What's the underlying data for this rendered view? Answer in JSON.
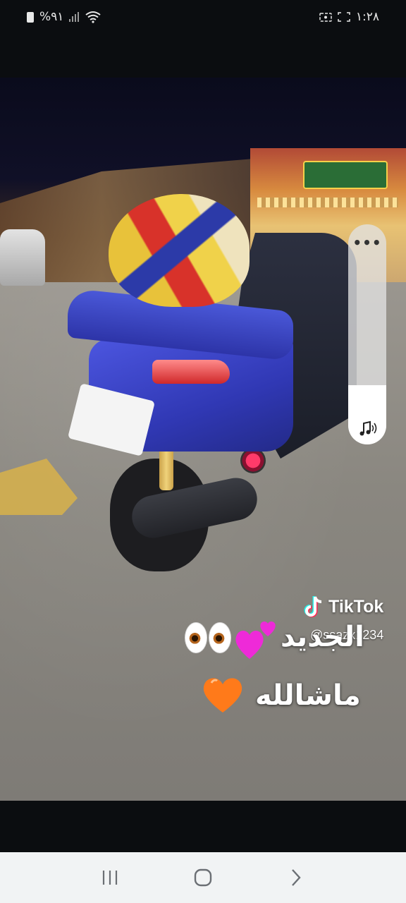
{
  "status_bar": {
    "battery_text": "%٩١",
    "time": "١:٢٨",
    "icons": [
      "battery-icon",
      "signal-icon",
      "wifi-icon",
      "screen-record-icon",
      "screenshot-icon"
    ]
  },
  "volume_panel": {
    "more_label": "•••",
    "level": 0.27,
    "icon": "music-note-icon"
  },
  "watermark": {
    "brand": "TikTok",
    "username": "@ssazx1234"
  },
  "caption": {
    "line1": "الجديد",
    "line2": "ماشالله",
    "emojis": [
      "eyes-icon",
      "two-hearts-icon",
      "orange-heart-icon"
    ]
  },
  "colors": {
    "volume_track": "#e1e1e1",
    "volume_fill": "#ffffff",
    "nav_bar": "#f1f3f4",
    "nav_icon": "#6b6f74"
  },
  "nav_bar": {
    "buttons": [
      "recent-apps-icon",
      "home-icon",
      "back-icon"
    ]
  }
}
